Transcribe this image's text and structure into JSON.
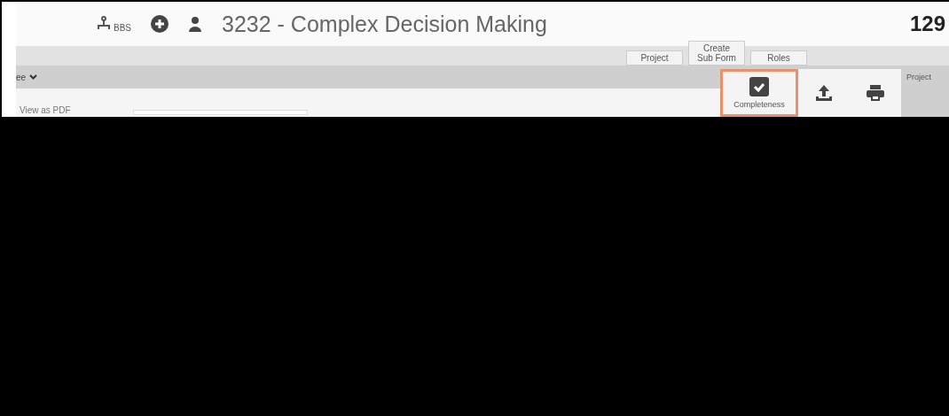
{
  "header": {
    "title": "3232 - Complex Decision Making",
    "count": "129",
    "icons": [
      {
        "kind": "tree",
        "label": "BBS"
      },
      {
        "kind": "plus"
      },
      {
        "kind": "person"
      }
    ]
  },
  "tabs": [
    {
      "label": "Project",
      "selected": false
    },
    {
      "label": "Create Sub Form",
      "selected": false
    },
    {
      "label": "Roles",
      "selected": false
    }
  ],
  "toolbar": {
    "dropdown": "ee",
    "view_link": "View as PDF",
    "tools": [
      {
        "kind": "check",
        "label": "Completeness",
        "selected": true
      },
      {
        "kind": "upload",
        "selected": false
      },
      {
        "kind": "print",
        "selected": false
      }
    ],
    "side_label": "Project"
  }
}
